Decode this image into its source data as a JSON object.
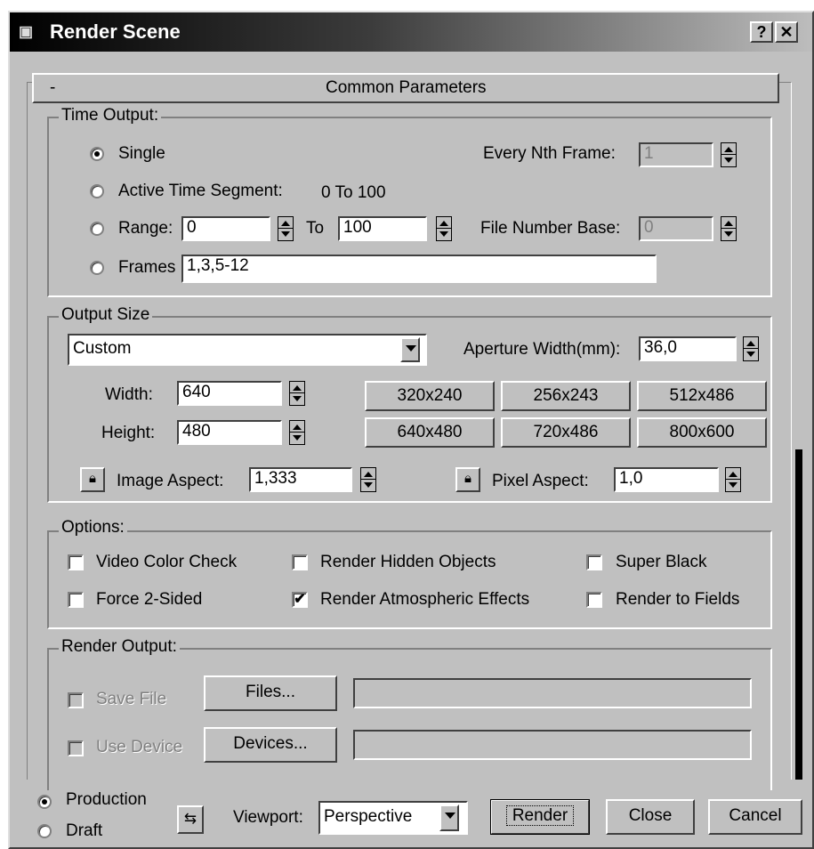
{
  "window": {
    "title": "Render Scene",
    "icon": "render-teapot-icon",
    "help_button": "?",
    "close_button": "✕"
  },
  "rollout": {
    "collapse": "-",
    "title": "Common Parameters"
  },
  "time_output": {
    "legend": "Time Output:",
    "single": "Single",
    "active_segment": "Active Time Segment:",
    "active_segment_value": "0 To 100",
    "range": "Range:",
    "range_from": "0",
    "to": "To",
    "range_to": "100",
    "frames": "Frames",
    "frames_value": "1,3,5-12",
    "every_nth_label": "Every Nth Frame:",
    "every_nth_value": "1",
    "file_number_base_label": "File Number Base:",
    "file_number_base_value": "0",
    "selected": "single"
  },
  "output_size": {
    "legend": "Output Size",
    "preset": "Custom",
    "aperture_label": "Aperture Width(mm):",
    "aperture_value": "36,0",
    "width_label": "Width:",
    "width_value": "640",
    "height_label": "Height:",
    "height_value": "480",
    "presets": [
      "320x240",
      "256x243",
      "512x486",
      "640x480",
      "720x486",
      "800x600"
    ],
    "image_aspect_label": "Image Aspect:",
    "image_aspect_value": "1,333",
    "pixel_aspect_label": "Pixel Aspect:",
    "pixel_aspect_value": "1,0",
    "lock_icon": "lock-icon"
  },
  "options": {
    "legend": "Options:",
    "video_color_check": "Video Color Check",
    "render_hidden": "Render Hidden Objects",
    "super_black": "Super Black",
    "force_2sided": "Force 2-Sided",
    "render_atmospheric": "Render Atmospheric Effects",
    "render_to_fields": "Render to Fields",
    "checked_mark": "✔"
  },
  "render_output": {
    "legend": "Render Output:",
    "save_file": "Save File",
    "files_button": "Files...",
    "use_device": "Use Device",
    "devices_button": "Devices...",
    "file_path": "",
    "device_name": ""
  },
  "bottom": {
    "production": "Production",
    "draft": "Draft",
    "swap_icon": "swap-arrow-icon",
    "swap_glyph": "⇆",
    "viewport_label": "Viewport:",
    "viewport_value": "Perspective",
    "render_button": "Render",
    "close_button": "Close",
    "cancel_button": "Cancel",
    "selected": "production"
  }
}
